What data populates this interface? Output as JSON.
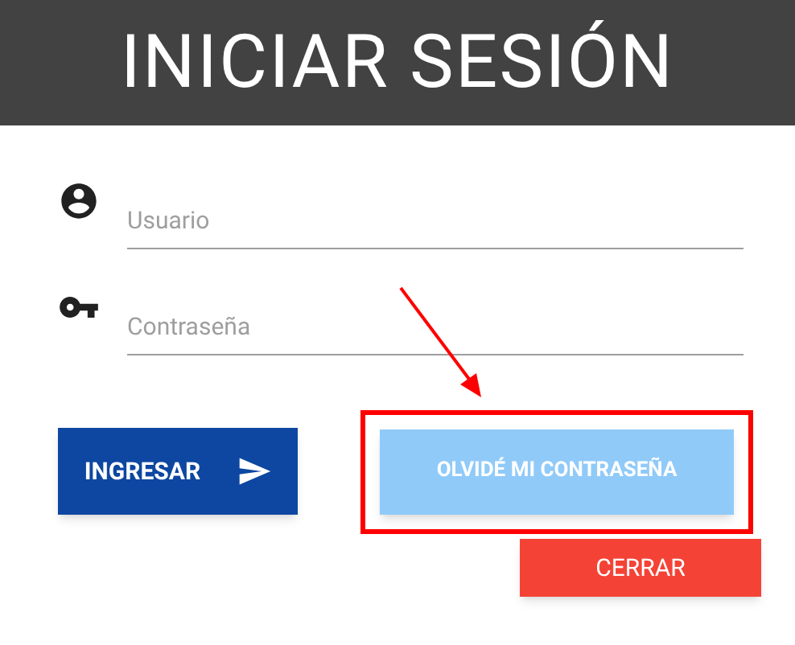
{
  "header": {
    "title": "INICIAR SESIÓN"
  },
  "fields": [
    {
      "kind": "user",
      "placeholder": "Usuario"
    },
    {
      "kind": "key",
      "placeholder": "Contraseña"
    }
  ],
  "buttons": [
    {
      "kind": "submit",
      "label": "INGRESAR",
      "highlighted": false
    },
    {
      "kind": "forgot",
      "label": "OLVIDÉ MI CONTRASEÑA",
      "highlighted": true
    }
  ],
  "close_button": {
    "label": "CERRAR"
  }
}
